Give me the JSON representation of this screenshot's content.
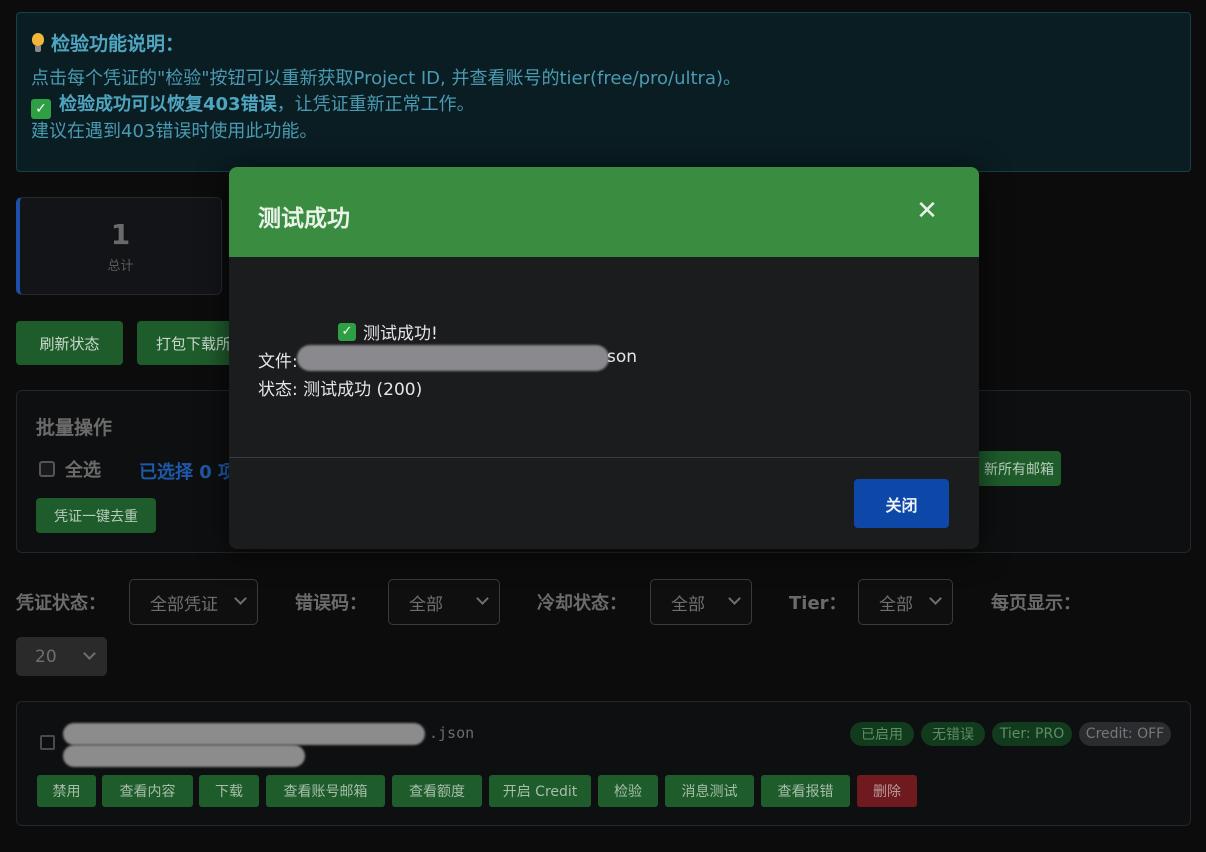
{
  "info": {
    "title": "检验功能说明：",
    "line1": "点击每个凭证的\"检验\"按钮可以重新获取Project ID, 并查看账号的tier(free/pro/ultra)。",
    "line2_bold": "检验成功可以恢复403错误",
    "line2_rest": "，让凭证重新正常工作。",
    "line3": "建议在遇到403错误时使用此功能。"
  },
  "stats": {
    "total_value": "1",
    "total_label": "总计"
  },
  "toolbar": {
    "refresh_label": "刷新状态",
    "pack_download_label": "打包下载所"
  },
  "batch": {
    "title": "批量操作",
    "select_all_label": "全选",
    "selected_count": "已选择 0 项",
    "refresh_emails_label": "新所有邮箱",
    "dedupe_label": "凭证一键去重"
  },
  "filters": {
    "cred_status_label": "凭证状态：",
    "cred_status_value": "全部凭证",
    "error_code_label": "错误码：",
    "error_code_value": "全部",
    "cooldown_label": "冷却状态：",
    "cooldown_value": "全部",
    "tier_label": "Tier：",
    "tier_value": "全部",
    "page_size_label": "每页显示：",
    "page_size_value": "20"
  },
  "credential": {
    "name_tail": ".json",
    "badges": {
      "enabled": "已启用",
      "no_error": "无错误",
      "tier": "Tier: PRO",
      "credit": "Credit: OFF"
    },
    "actions": {
      "disable": "禁用",
      "view_content": "查看内容",
      "download": "下载",
      "view_email": "查看账号邮箱",
      "view_quota": "查看额度",
      "enable_credit": "开启 Credit",
      "verify": "检验",
      "message_test": "消息测试",
      "view_errors": "查看报错",
      "delete": "删除"
    }
  },
  "modal": {
    "title": "测试成功",
    "close_icon": "✕",
    "success_msg": "测试成功!",
    "file_prefix": "文件:",
    "file_tail": "son",
    "status_line": "状态: 测试成功 (200)",
    "ok_label": "关闭"
  },
  "colors": {
    "modal_header": "#3a8c40",
    "primary_button": "#0d47a8",
    "action_button": "#1e5c2c",
    "danger_button": "#6e1a1f"
  }
}
